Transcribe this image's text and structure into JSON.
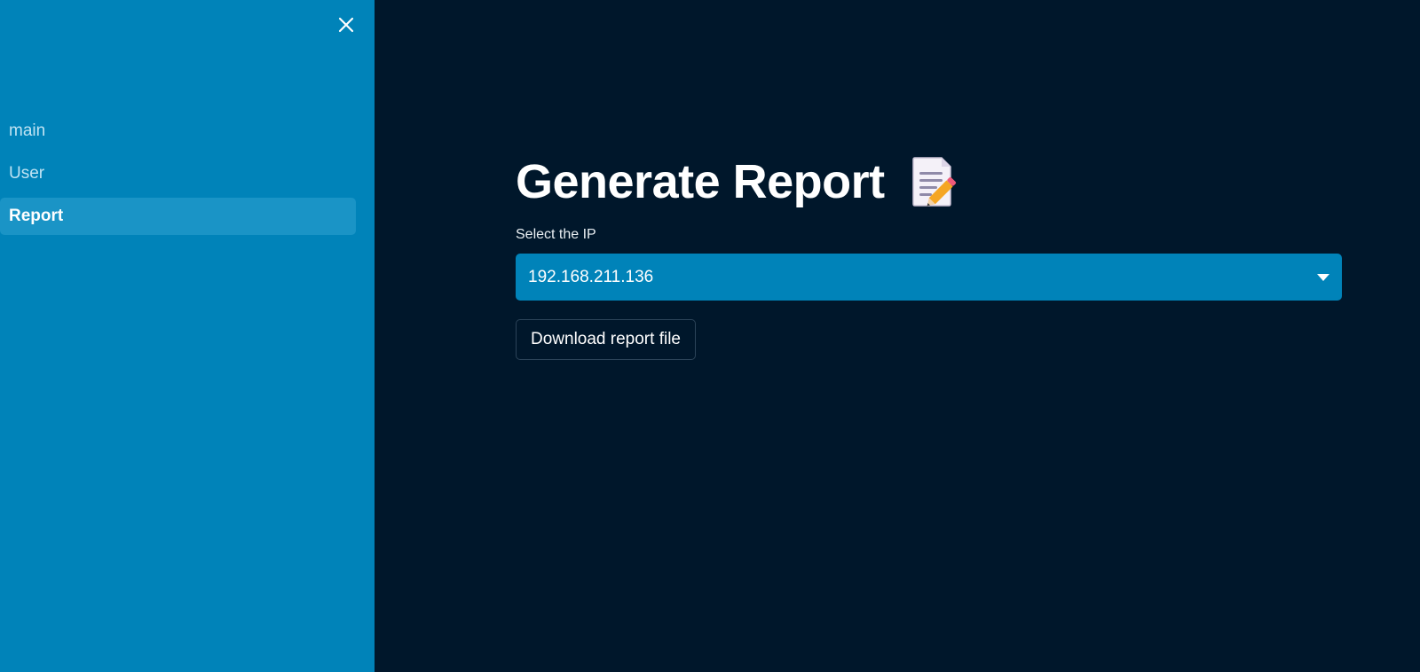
{
  "sidebar": {
    "close_icon": "close-icon",
    "items": [
      {
        "label": "main",
        "active": false
      },
      {
        "label": "User",
        "active": false
      },
      {
        "label": "Report",
        "active": true
      }
    ]
  },
  "main": {
    "title": "Generate Report",
    "title_icon": "memo-icon",
    "select": {
      "label": "Select the IP",
      "value": "192.168.211.136",
      "icon": "chevron-down-icon"
    },
    "download_label": "Download report file"
  },
  "colors": {
    "sidebar_bg": "#0083b9",
    "main_bg": "#00172b",
    "active_item_bg": "#1a94c6",
    "select_bg": "#0083b9"
  }
}
